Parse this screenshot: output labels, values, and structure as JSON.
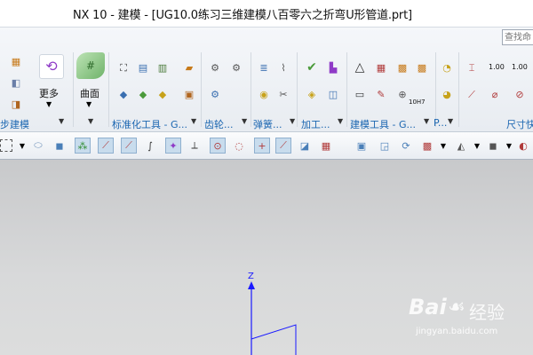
{
  "window": {
    "title": "NX 10 - 建模 - [UG10.0练习三维建模八百零六之折弯U形管道.prt]"
  },
  "search": {
    "placeholder": "查找命"
  },
  "ribbon": {
    "more_label": "更多",
    "surface_label": "曲面",
    "groups": [
      "步建模",
      "标准化工具 - G...",
      "齿轮...",
      "弹簧...",
      "加工...",
      "建模工具 - G...",
      "P...",
      "尺寸快"
    ],
    "dim_labels": [
      "1.00",
      "1.00",
      "10H7"
    ]
  },
  "viewport": {
    "axis_label": "Z"
  },
  "watermark": {
    "brand": "Bai",
    "brand_suffix": "经验",
    "url": "jingyan.baidu.com"
  },
  "colors": {
    "group_label": "#1b66b1",
    "axis_blue": "#1a1aff",
    "viewport_bg": "#d2d3d4"
  },
  "icons": [
    "cube-icon",
    "feature-icon",
    "swap-icon",
    "mesh-surface-icon",
    "std-part-icon",
    "gear-icon",
    "spring-icon",
    "check-icon",
    "triangle-icon",
    "table-icon",
    "dimension-icon",
    "cross-icon",
    "circle-icon",
    "rotate-icon"
  ]
}
